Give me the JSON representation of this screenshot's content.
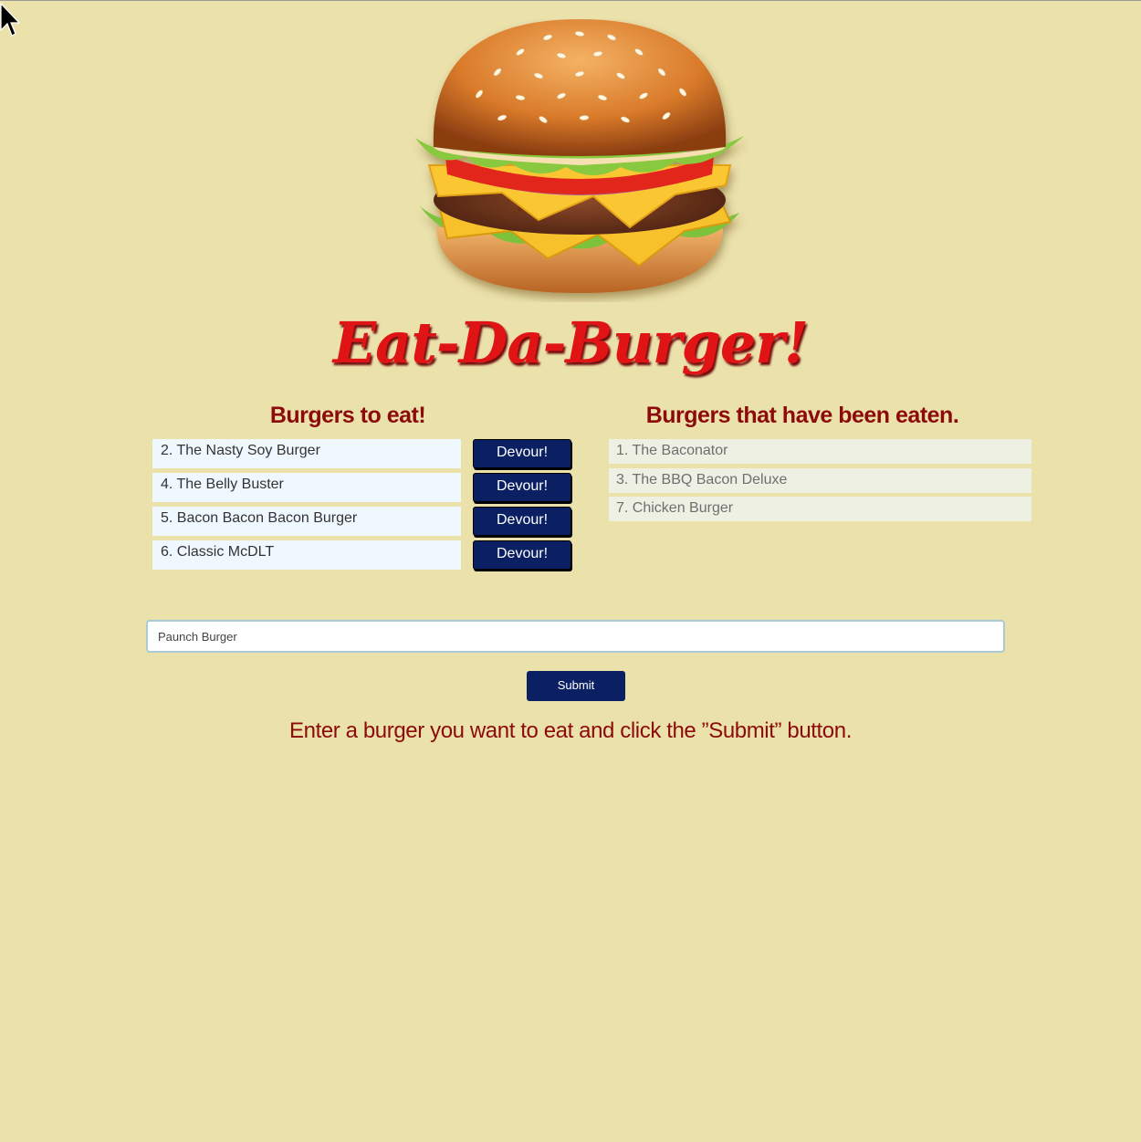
{
  "page": {
    "title": "Eat-Da-Burger!",
    "colors": {
      "background": "#ebe1ab",
      "title_red": "#e01414",
      "heading_red": "#8c0a0a",
      "button_navy": "#0b1f63",
      "to_eat_item_bg": "#f0f8ff",
      "eaten_item_bg": "#eef0e4"
    }
  },
  "logo": {
    "icon": "burger-image"
  },
  "to_eat": {
    "heading": "Burgers to eat!",
    "button_label": "Devour!",
    "items": [
      {
        "name": "2. The Nasty Soy Burger",
        "button": "Devour!"
      },
      {
        "name": "4. The Belly Buster",
        "button": "Devour!"
      },
      {
        "name": "5. Bacon Bacon Bacon Burger",
        "button": "Devour!"
      },
      {
        "name": "6. Classic McDLT",
        "button": "Devour!"
      }
    ]
  },
  "eaten": {
    "heading": "Burgers that have been eaten.",
    "items": [
      {
        "name": "1. The Baconator"
      },
      {
        "name": "3. The BBQ Bacon Deluxe"
      },
      {
        "name": "7. Chicken Burger"
      }
    ]
  },
  "form": {
    "input_value": "Paunch Burger",
    "submit_label": "Submit",
    "instructions": "Enter a burger you want to eat and click the ”Submit” button."
  }
}
